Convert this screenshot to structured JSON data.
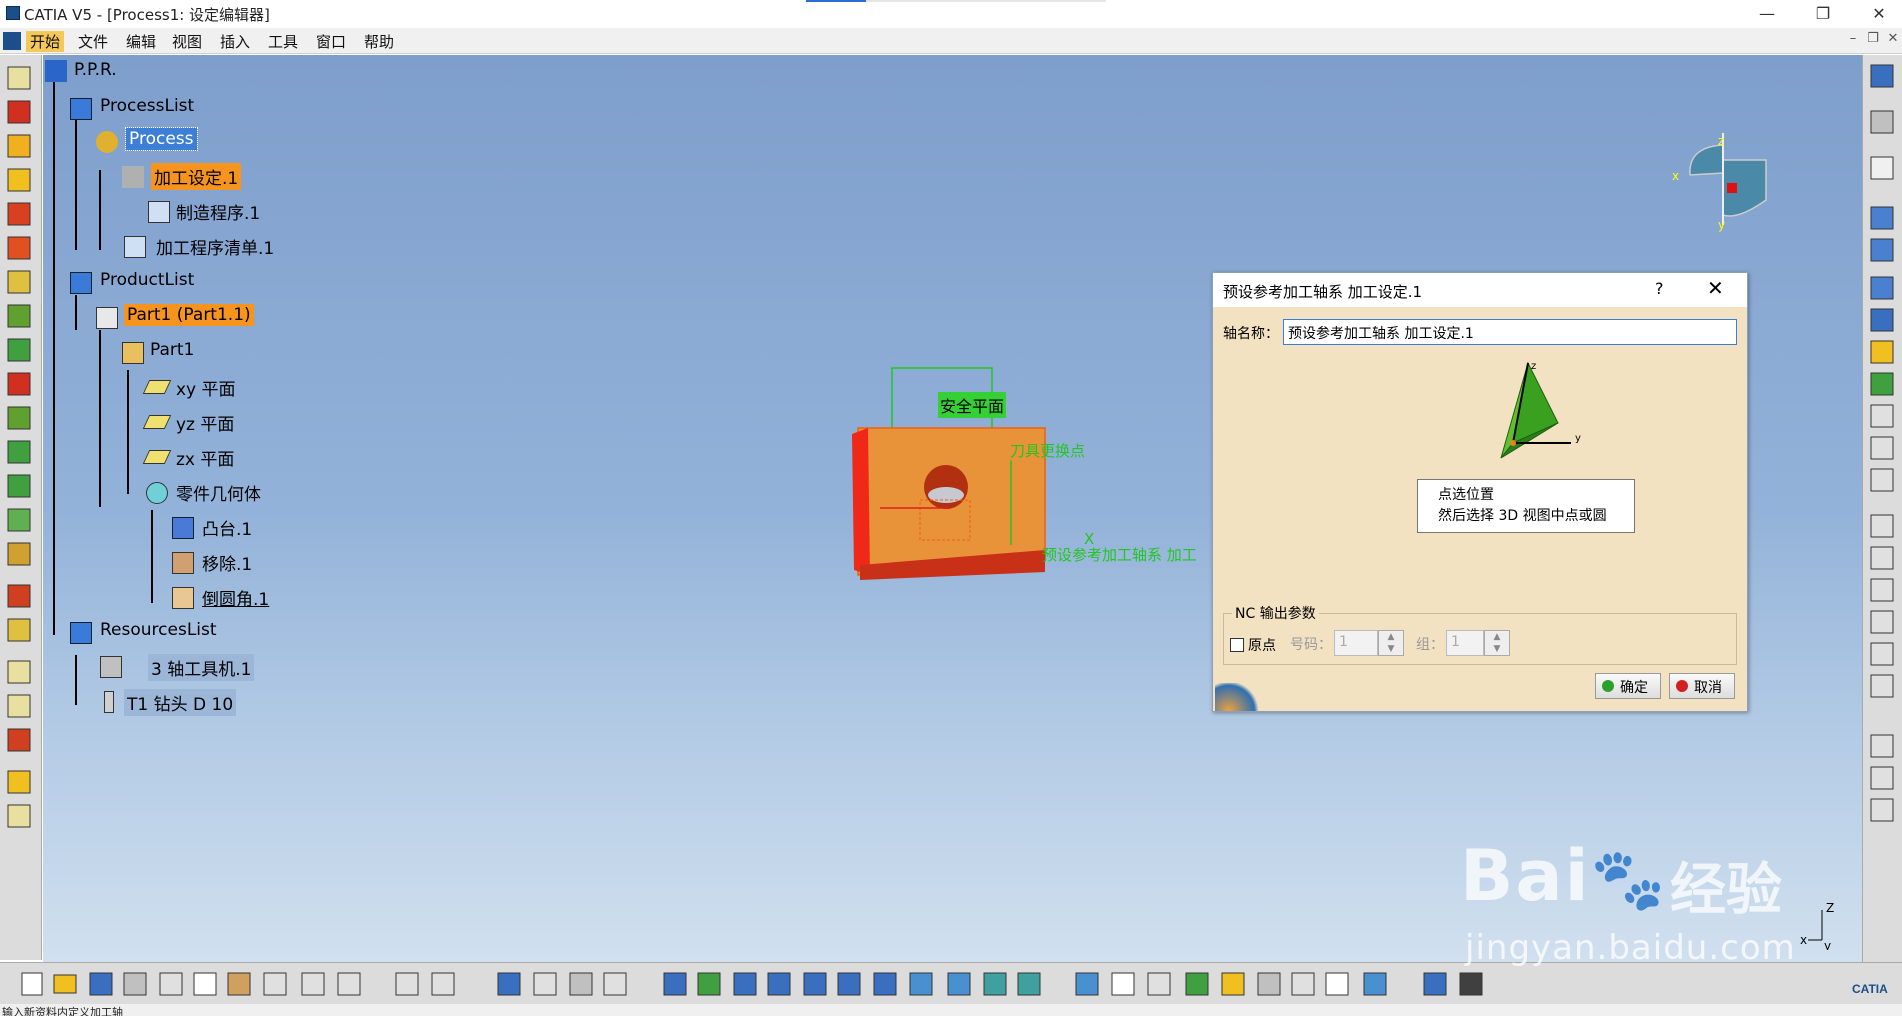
{
  "window": {
    "title": "CATIA V5 - [Process1: 设定编辑器]",
    "minimize_icon": "minimize-icon",
    "restore_icon": "restore-icon",
    "close_icon": "close-icon"
  },
  "menubar": {
    "items": [
      "开始",
      "文件",
      "编辑",
      "视图",
      "插入",
      "工具",
      "窗口",
      "帮助"
    ]
  },
  "tree": {
    "root": "P.P.R.",
    "process_list": "ProcessList",
    "process": "Process",
    "machining_setup": "加工设定.1",
    "manufacturing_program": "制造程序.1",
    "machining_program_list": "加工程序清单.1",
    "product_list": "ProductList",
    "part_instance": "Part1 (Part1.1)",
    "part": "Part1",
    "xy_plane": "xy 平面",
    "yz_plane": "yz 平面",
    "zx_plane": "zx 平面",
    "part_body": "零件几何体",
    "pad": "凸台.1",
    "pocket": "移除.1",
    "fillet": "倒圆角.1",
    "resources_list": "ResourcesList",
    "machine": "3 轴工具机.1",
    "tool": "T1 钻头 D 10"
  },
  "viewport": {
    "safe_plane_label": "安全平面",
    "tool_change_label": "刀具更换点",
    "axis_system_label": "预设参考加工轴系 加工",
    "axis_x": "X"
  },
  "dialog": {
    "title": "预设参考加工轴系 加工设定.1",
    "help": "?",
    "close": "✕",
    "axis_name_label": "轴名称：",
    "axis_name_value": "预设参考加工轴系 加工设定.1",
    "tooltip_line1": "点选位置",
    "tooltip_line2": "然后选择 3D 视图中点或圆",
    "axis_z": "z",
    "axis_y": "y",
    "nc_group_title": "NC 输出参数",
    "origin_checkbox": "原点",
    "origin_checked": false,
    "number_label": "号码：",
    "number_value": "1",
    "group_label": "组：",
    "group_value": "1",
    "ok_button": "确定",
    "cancel_button": "取消"
  },
  "compass": {
    "x": "x",
    "y": "y",
    "z": "z"
  },
  "corner_axes": {
    "x": "x",
    "y": "y",
    "z": "Z"
  },
  "watermark": {
    "logo": "Bai",
    "brand": "经验",
    "url": "jingyan.baidu.com"
  },
  "status": {
    "text": "输入新资料内定义加工轴"
  },
  "catia_logo": "CATIA",
  "colors": {
    "viewport_top": "#7e9ecc",
    "viewport_bottom": "#d1e0ef",
    "highlight_orange": "#f7941d",
    "highlight_blue": "#3c7fd4",
    "dialog_bg": "#f3e2c2",
    "annotation_green": "#22c622",
    "part_orange": "#e8923a"
  }
}
